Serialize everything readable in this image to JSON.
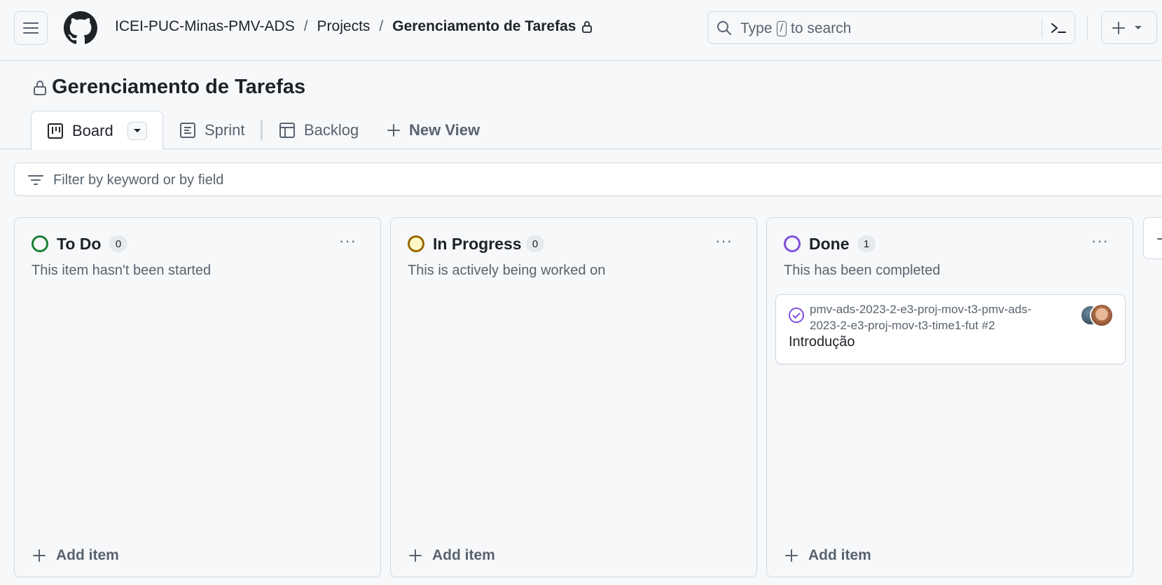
{
  "header": {
    "breadcrumb": [
      "ICEI-PUC-Minas-PMV-ADS",
      "Projects",
      "Gerenciamento de Tarefas"
    ],
    "breadcrumb_sep": "/",
    "search_placeholder_before": "Type",
    "search_key": "/",
    "search_placeholder_after": "to search"
  },
  "project": {
    "title": "Gerenciamento de Tarefas"
  },
  "tabs": [
    {
      "label": "Board",
      "icon": "board-icon",
      "active": true
    },
    {
      "label": "Sprint",
      "icon": "table-icon"
    },
    {
      "label": "Backlog",
      "icon": "grid-icon"
    },
    {
      "label": "New View",
      "icon": "plus-icon"
    }
  ],
  "filter": {
    "placeholder": "Filter by keyword or by field"
  },
  "columns": [
    {
      "name": "To Do",
      "count": "0",
      "description": "This item hasn't been started",
      "color": "#1a7f37",
      "add_label": "Add item",
      "menu": "···"
    },
    {
      "name": "In Progress",
      "count": "0",
      "description": "This is actively being worked on",
      "color": "#9a6700",
      "add_label": "Add item",
      "menu": "···"
    },
    {
      "name": "Done",
      "count": "1",
      "description": "This has been completed",
      "color": "#8250df",
      "add_label": "Add item",
      "menu": "···",
      "cards": [
        {
          "repo": "pmv-ads-2023-2-e3-proj-mov-t3-pmv-ads-2023-2-e3-proj-mov-t3-time1-fut #2",
          "title": "Introdução"
        }
      ]
    }
  ],
  "colors": {
    "bg": "#f6f8fa",
    "border": "#d1d9e0",
    "muted": "#59636e",
    "done": "#8250df"
  }
}
